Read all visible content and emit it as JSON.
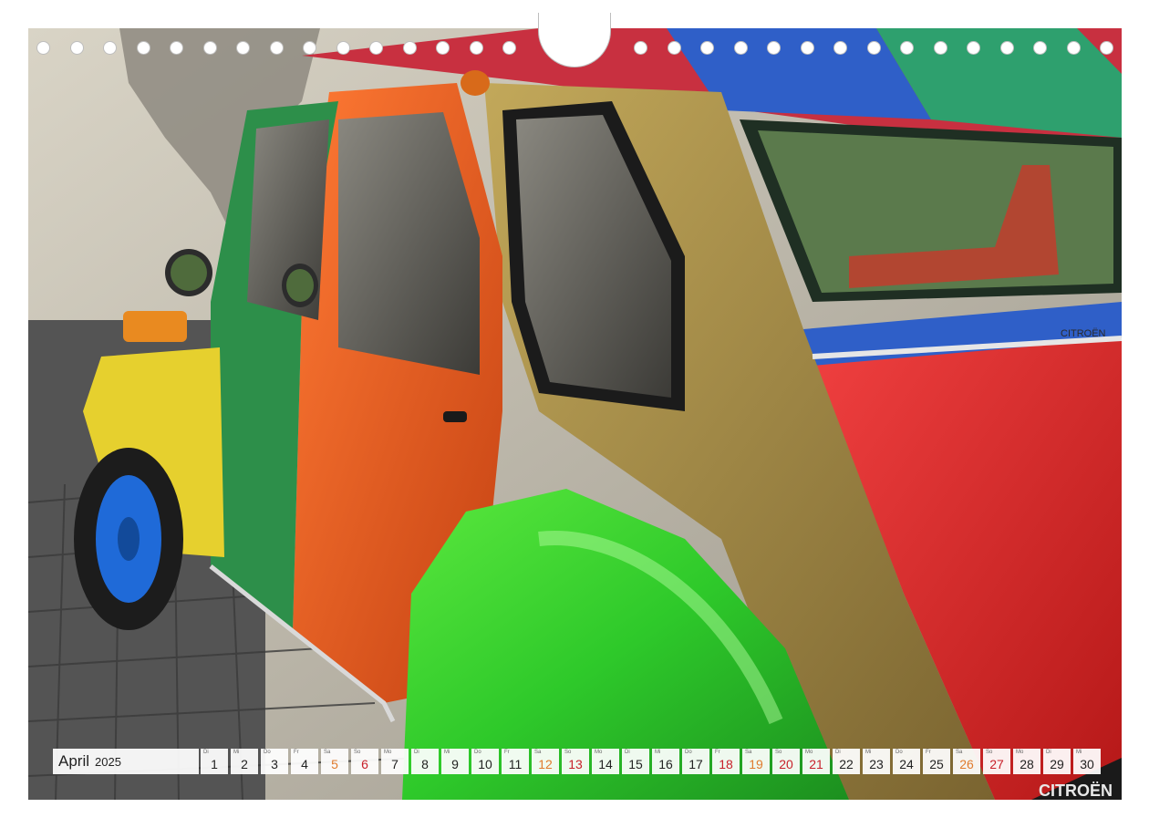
{
  "calendar": {
    "month": "April",
    "year": "2025",
    "days": [
      {
        "wd": "Di",
        "num": "1",
        "type": "weekday"
      },
      {
        "wd": "Mi",
        "num": "2",
        "type": "weekday"
      },
      {
        "wd": "Do",
        "num": "3",
        "type": "weekday"
      },
      {
        "wd": "Fr",
        "num": "4",
        "type": "weekday"
      },
      {
        "wd": "Sa",
        "num": "5",
        "type": "sat"
      },
      {
        "wd": "So",
        "num": "6",
        "type": "sun"
      },
      {
        "wd": "Mo",
        "num": "7",
        "type": "weekday"
      },
      {
        "wd": "Di",
        "num": "8",
        "type": "weekday"
      },
      {
        "wd": "Mi",
        "num": "9",
        "type": "weekday"
      },
      {
        "wd": "Do",
        "num": "10",
        "type": "weekday"
      },
      {
        "wd": "Fr",
        "num": "11",
        "type": "weekday"
      },
      {
        "wd": "Sa",
        "num": "12",
        "type": "sat"
      },
      {
        "wd": "So",
        "num": "13",
        "type": "sun"
      },
      {
        "wd": "Mo",
        "num": "14",
        "type": "weekday"
      },
      {
        "wd": "Di",
        "num": "15",
        "type": "weekday"
      },
      {
        "wd": "Mi",
        "num": "16",
        "type": "weekday"
      },
      {
        "wd": "Do",
        "num": "17",
        "type": "weekday"
      },
      {
        "wd": "Fr",
        "num": "18",
        "type": "sun"
      },
      {
        "wd": "Sa",
        "num": "19",
        "type": "sat"
      },
      {
        "wd": "So",
        "num": "20",
        "type": "sun"
      },
      {
        "wd": "Mo",
        "num": "21",
        "type": "sun"
      },
      {
        "wd": "Di",
        "num": "22",
        "type": "weekday"
      },
      {
        "wd": "Mi",
        "num": "23",
        "type": "weekday"
      },
      {
        "wd": "Do",
        "num": "24",
        "type": "weekday"
      },
      {
        "wd": "Fr",
        "num": "25",
        "type": "weekday"
      },
      {
        "wd": "Sa",
        "num": "26",
        "type": "sat"
      },
      {
        "wd": "So",
        "num": "27",
        "type": "sun"
      },
      {
        "wd": "Mo",
        "num": "28",
        "type": "weekday"
      },
      {
        "wd": "Di",
        "num": "29",
        "type": "weekday"
      },
      {
        "wd": "Mi",
        "num": "30",
        "type": "weekday"
      }
    ]
  },
  "photo": {
    "plate_text": "CITROËN",
    "badge_text": "CITROËN"
  },
  "colors": {
    "saturday": "#e07b2e",
    "sunday": "#c8202a",
    "car_red": "#d82a2a",
    "car_orange": "#e9591f",
    "car_green": "#2d8f4a",
    "car_lime": "#3fcf35",
    "car_yellow": "#e6d02e",
    "car_gold": "#a68a3a",
    "car_blue": "#2f5fc8",
    "hub_blue": "#1f6ad8"
  }
}
